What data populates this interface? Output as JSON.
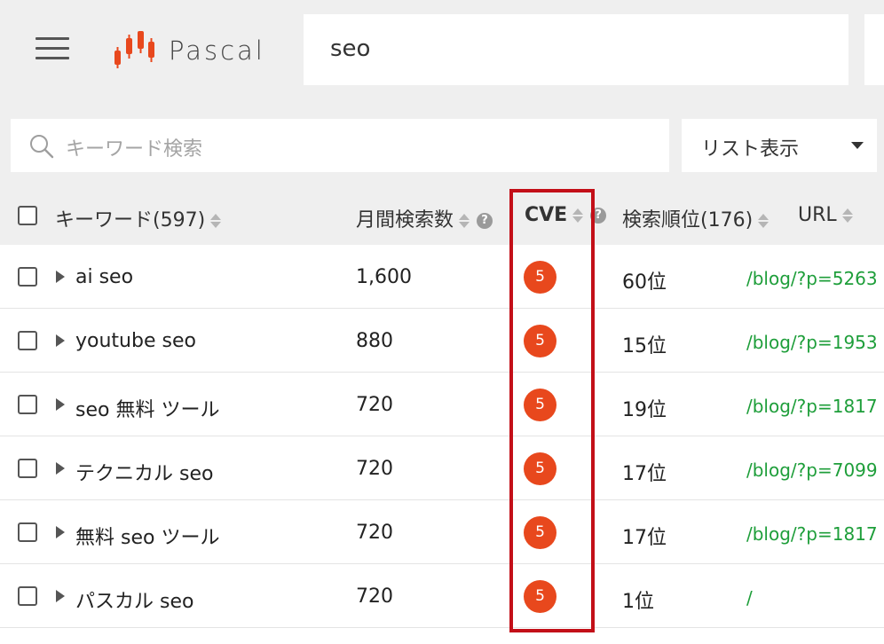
{
  "header": {
    "logo_text": "Pascal",
    "search_value": "seo"
  },
  "filter": {
    "placeholder": "キーワード検索",
    "view_mode": "リスト表示"
  },
  "columns": {
    "keyword": "キーワード(597)",
    "volume": "月間検索数",
    "cve": "CVE",
    "rank": "検索順位(176)",
    "url": "URL"
  },
  "rows": [
    {
      "keyword": "ai seo",
      "volume": "1,600",
      "cve": "5",
      "rank": "60位",
      "url": "/blog/?p=5263"
    },
    {
      "keyword": "youtube seo",
      "volume": "880",
      "cve": "5",
      "rank": "15位",
      "url": "/blog/?p=1953"
    },
    {
      "keyword": "seo 無料 ツール",
      "volume": "720",
      "cve": "5",
      "rank": "19位",
      "url": "/blog/?p=1817"
    },
    {
      "keyword": "テクニカル seo",
      "volume": "720",
      "cve": "5",
      "rank": "17位",
      "url": "/blog/?p=7099"
    },
    {
      "keyword": "無料 seo ツール",
      "volume": "720",
      "cve": "5",
      "rank": "17位",
      "url": "/blog/?p=1817"
    },
    {
      "keyword": "パスカル seo",
      "volume": "720",
      "cve": "5",
      "rank": "1位",
      "url": "/"
    }
  ],
  "colors": {
    "brand_orange": "#e8481d",
    "url_green": "#1e9e3a",
    "highlight_red": "#c30f18"
  }
}
